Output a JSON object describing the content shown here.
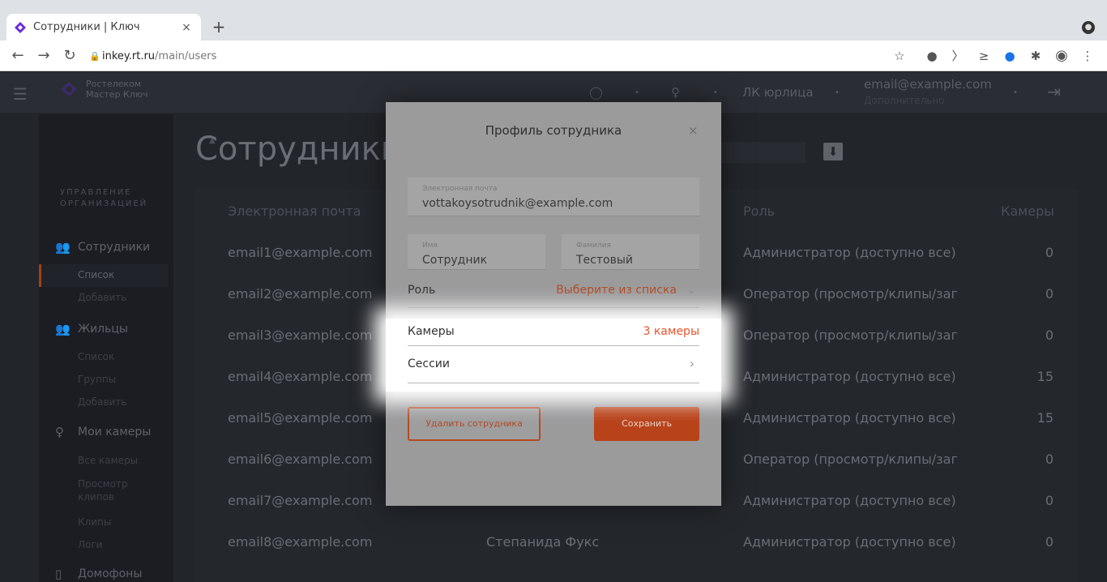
{
  "browser": {
    "tab_title": "Сотрудники | Ключ",
    "tab_close": "×",
    "new_tab": "+",
    "url_host": "inkey.rt.ru",
    "url_path": "/main/users"
  },
  "header": {
    "logo_line1": "Ростелеком",
    "logo_line2": "Мастер Ключ",
    "lk_label": "ЛК юрлица",
    "email": "email@example.com",
    "sub": "Дополнительно"
  },
  "sidebar": {
    "section_line1": "УПРАВЛЕНИЕ",
    "section_line2": "ОРГАНИЗАЦИЕЙ",
    "groups": [
      {
        "label": "Сотрудники",
        "subs": [
          "Список",
          "Добавить"
        ]
      },
      {
        "label": "Жильцы",
        "subs": [
          "Список",
          "Группы",
          "Добавить"
        ]
      },
      {
        "label": "Мои камеры",
        "subs": [
          "Все камеры",
          "Просмотр клипов",
          "Клипы",
          "Логи"
        ]
      },
      {
        "label": "Домофоны",
        "subs": []
      }
    ]
  },
  "page": {
    "title": "Сотрудники"
  },
  "table": {
    "columns": [
      "Электронная почта",
      "Роль",
      "Камеры"
    ],
    "rows": [
      {
        "email": "email1@example.com",
        "name": "",
        "role": "Администратор (доступно все)",
        "cams": "0"
      },
      {
        "email": "email2@example.com",
        "name": "",
        "role": "Оператор (просмотр/клипы/заг",
        "cams": "0"
      },
      {
        "email": "email3@example.com",
        "name": "",
        "role": "Оператор (просмотр/клипы/заг",
        "cams": "0"
      },
      {
        "email": "email4@example.com",
        "name": "",
        "role": "Администратор (доступно все)",
        "cams": "15"
      },
      {
        "email": "email5@example.com",
        "name": "",
        "role": "Администратор (доступно все)",
        "cams": "15"
      },
      {
        "email": "email6@example.com",
        "name": "",
        "role": "Оператор (просмотр/клипы/заг",
        "cams": "0"
      },
      {
        "email": "email7@example.com",
        "name": "",
        "role": "Администратор (доступно все)",
        "cams": "0"
      },
      {
        "email": "email8@example.com",
        "name": "Степанида Фукс",
        "role": "Администратор (доступно все)",
        "cams": "0"
      }
    ]
  },
  "modal": {
    "title": "Профиль сотрудника",
    "close": "×",
    "email_label": "Электронная почта",
    "email_value": "vottakoysotrudnik@example.com",
    "first_name_label": "Имя",
    "first_name_value": "Сотрудник",
    "last_name_label": "Фамилия",
    "last_name_value": "Тестовый",
    "role_label": "Роль",
    "role_value": "Выберите из списка",
    "cameras_label": "Камеры",
    "cameras_value": "3 камеры",
    "sessions_label": "Сессии",
    "delete_button": "Удалить сотрудника",
    "save_button": "Сохранить"
  },
  "colors": {
    "accent": "#e8542a"
  }
}
